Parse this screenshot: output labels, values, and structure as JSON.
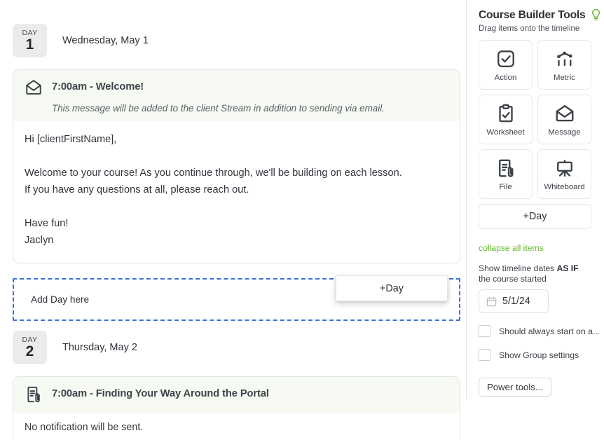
{
  "timeline": {
    "days": [
      {
        "badge_word": "DAY",
        "number": "1",
        "date_label": "Wednesday, May 1"
      },
      {
        "badge_word": "DAY",
        "number": "2",
        "date_label": "Thursday, May 2"
      }
    ],
    "items": [
      {
        "icon": "envelope-icon",
        "title": "7:00am - Welcome!",
        "subtitle": "This message will be added to the client Stream in addition to sending via email.",
        "body": "Hi [clientFirstName],\n\nWelcome to your course! As you continue through, we'll be building on each lesson.\nIf you have any questions at all, please reach out.\n\nHave fun!\nJaclyn"
      },
      {
        "icon": "file-attachment-icon",
        "title": "7:00am - Finding Your Way Around the Portal",
        "body": "No notification will be sent."
      }
    ],
    "dropzone": {
      "label": "Add Day here"
    },
    "drag_ghost": {
      "label": "+Day"
    }
  },
  "sidebar": {
    "title": "Course Builder Tools",
    "title_icon": "lightbulb-icon",
    "subtitle": "Drag items onto the timeline",
    "tools": [
      {
        "label": "Action",
        "icon": "checkbox-square-icon"
      },
      {
        "label": "Metric",
        "icon": "chart-metric-icon"
      },
      {
        "label": "Worksheet",
        "icon": "clipboard-check-icon"
      },
      {
        "label": "Message",
        "icon": "envelope-icon"
      },
      {
        "label": "File",
        "icon": "file-attachment-icon"
      },
      {
        "label": "Whiteboard",
        "icon": "easel-icon"
      }
    ],
    "add_day_label": "+Day",
    "collapse_link": "collapse all items",
    "asif_prefix": "Show timeline dates ",
    "asif_emphasis": "AS IF",
    "asif_suffix": " the course started",
    "date_value": "5/1/24",
    "date_icon": "calendar-icon",
    "checkboxes": [
      {
        "label": "Should always start on a...",
        "checked": false
      },
      {
        "label": "Show Group settings",
        "checked": false
      }
    ],
    "power_tools_label": "Power tools..."
  },
  "colors": {
    "accent_green": "#64b82c",
    "card_header_bg": "#f6faf2",
    "drop_border_blue": "#3b72d9",
    "badge_bg": "#ebebeb"
  }
}
